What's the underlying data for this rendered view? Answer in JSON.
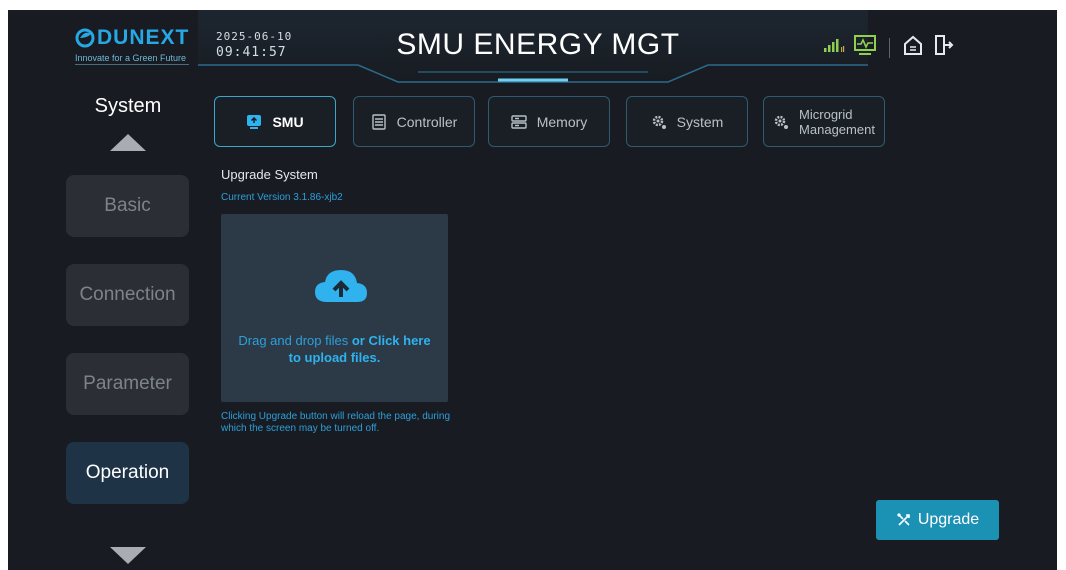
{
  "brand": {
    "logo_text": "DUNEXT",
    "slogan": "Innovate for a Green Future",
    "color": "#27a7e3"
  },
  "header": {
    "date": "2025-06-10",
    "time": "09:41:57",
    "title": "SMU ENERGY MGT",
    "icons": [
      "signal-icon",
      "monitor-icon",
      "home-icon",
      "logout-icon"
    ],
    "signal_label": "ıı"
  },
  "sidebar": {
    "title": "System",
    "items": [
      {
        "label": "Basic",
        "active": false
      },
      {
        "label": "Connection",
        "active": false
      },
      {
        "label": "Parameter",
        "active": false
      },
      {
        "label": "Operation",
        "active": true
      }
    ]
  },
  "tabs": [
    {
      "label": "SMU",
      "icon": "smu-icon",
      "active": true
    },
    {
      "label": "Controller",
      "icon": "controller-icon",
      "active": false
    },
    {
      "label": "Memory",
      "icon": "memory-icon",
      "active": false
    },
    {
      "label": "System",
      "icon": "gear-icon",
      "active": false
    },
    {
      "label_line1": "Microgrid",
      "label_line2": "Management",
      "icon": "gears-icon",
      "active": false
    }
  ],
  "upgrade": {
    "title": "Upgrade System",
    "current_version": "Current Version 3.1.86-xjb2",
    "drop_text": "Drag and drop files ",
    "drop_click": "or Click here",
    "drop_text2": "to upload files.",
    "note": "Clicking Upgrade button will reload the page, during which the screen may be turned off.",
    "button_label": "Upgrade"
  },
  "colors": {
    "background": "#181c22",
    "accent": "#2d9fd9",
    "button": "#1b91b4",
    "active_nav": "#1f3347"
  }
}
